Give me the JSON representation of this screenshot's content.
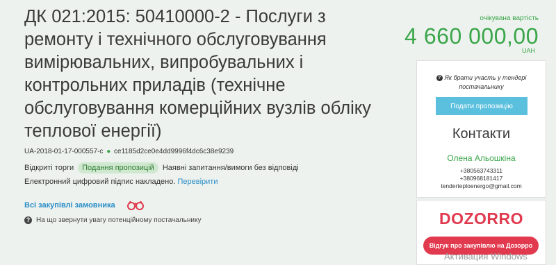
{
  "tender": {
    "title": "ДК 021:2015: 50410000-2 - Послуги з ремонту і технічного обслуговування вимірювальних, випробувальних і контрольних приладів (технічне обслуговування комерційних вузлів обліку теплової енергії)",
    "id": "UA-2018-01-17-000557-c",
    "hash": "ce1185d2ce0e4dd9996f4dc6c38e9239",
    "procedure": "Відкриті торги",
    "status_badge": "Подання пропозицій",
    "questions_note": "Наявні запитання/вимоги без відповіді",
    "signature_text": "Електронний цифровий підпис накладено.",
    "verify_link": "Перевірити",
    "all_purchases_link": "Всі закупівлі замовника",
    "attention_note": "На що звернути увагу потенційному постачальнику"
  },
  "price": {
    "label": "очікувана вартість",
    "amount": "4 660 000,00",
    "currency": "UAH"
  },
  "sidebar": {
    "how_to": "Як брати участь у тендері постачальнику",
    "submit_button": "Подати пропозицію",
    "contacts_title": "Контакти",
    "contact_name": "Олена Альошкіна",
    "phone1": "+380563743311",
    "phone2": "+380968181417",
    "email": "tenderteploenergo@gmail.com",
    "dozorro_logo": "DOZORRO",
    "dozorro_button": "Відгук про закупівлю на Дозорро"
  },
  "watermark": "Активация Windows"
}
